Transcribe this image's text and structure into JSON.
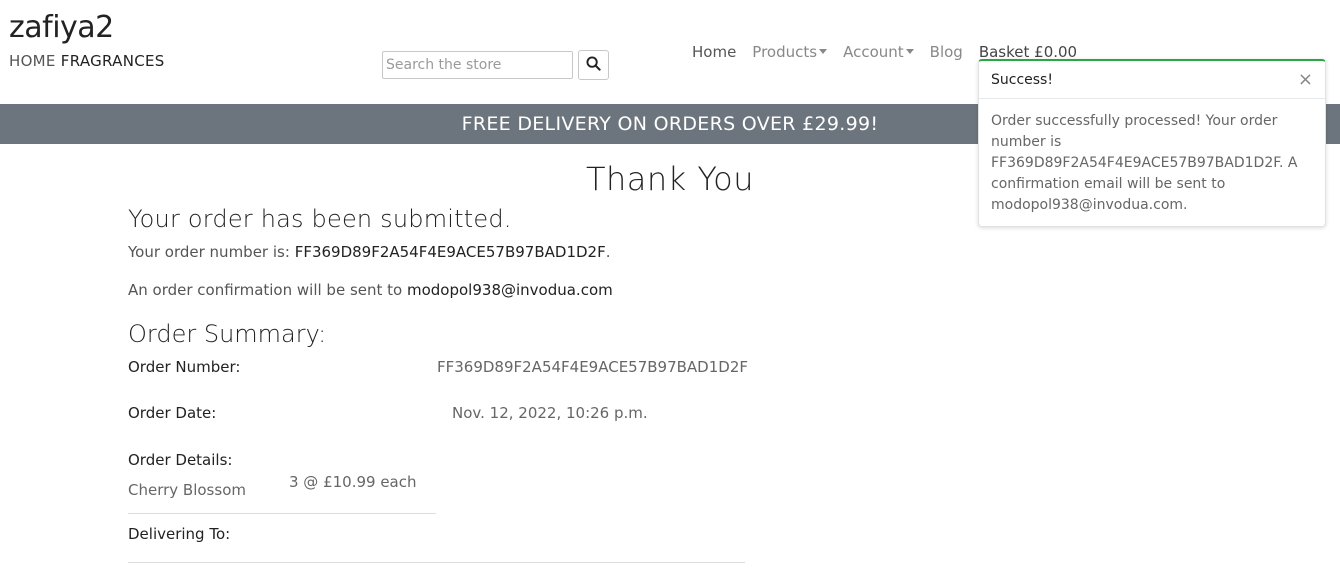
{
  "brand": {
    "title": "zafiya2",
    "sub_light": "HOME",
    "sub_bold": "FRAGRANCES"
  },
  "search": {
    "placeholder": "Search the store",
    "icon": "search-icon"
  },
  "nav": {
    "home": "Home",
    "products": "Products",
    "account": "Account",
    "blog": "Blog",
    "basket": "Basket £0.00"
  },
  "banner": {
    "text": "FREE DELIVERY ON ORDERS OVER £29.99!"
  },
  "page": {
    "title": "Thank You",
    "submitted": "Your order has been submitted.",
    "order_number_prefix": "Your order number is:",
    "order_number": "FF369D89F2A54F4E9ACE57B97BAD1D2F",
    "order_number_suffix": ".",
    "confirm_prefix": "An order confirmation will be sent to",
    "email": "modopol938@invodua.com"
  },
  "summary": {
    "heading": "Order Summary:",
    "order_number_label": "Order Number:",
    "order_number_value": "FF369D89F2A54F4E9ACE57B97BAD1D2F",
    "order_date_label": "Order Date:",
    "order_date_value": "Nov. 12, 2022, 10:26 p.m.",
    "details_label": "Order Details:",
    "items": [
      {
        "name": "Cherry Blossom",
        "qty": "3 @ £10.99 each"
      }
    ],
    "delivering_label": "Delivering To:"
  },
  "toast": {
    "title": "Success!",
    "close": "×",
    "body": "Order successfully processed! Your order number is FF369D89F2A54F4E9ACE57B97BAD1D2F. A confirmation email will be sent to modopol938@invodua.com.",
    "accent_color": "#28a745"
  },
  "colors": {
    "banner_bg": "#6c757d"
  }
}
